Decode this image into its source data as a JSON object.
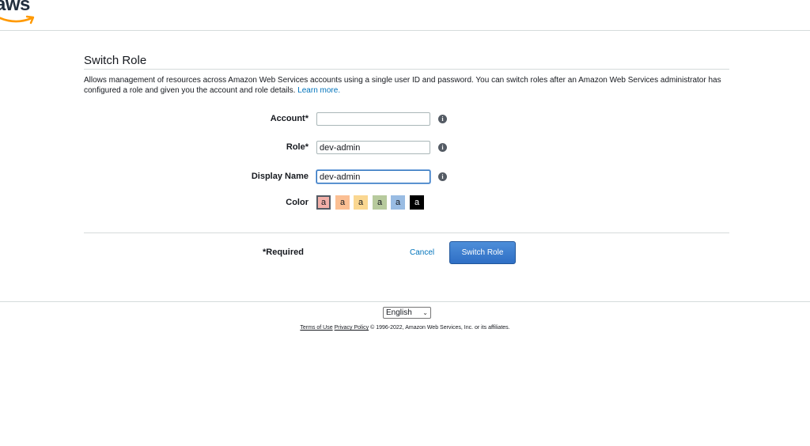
{
  "header": {
    "logo_text": "aws",
    "logo_colors": {
      "text": "#232f3e",
      "smile": "#ff9900"
    }
  },
  "page": {
    "title": "Switch Role",
    "description": "Allows management of resources across Amazon Web Services accounts using a single user ID and password. You can switch roles after an Amazon Web Services administrator has configured a role and given you the account and role details.",
    "learn_more": "Learn more."
  },
  "form": {
    "account": {
      "label": "Account*",
      "value": ""
    },
    "role": {
      "label": "Role*",
      "value": "dev-admin"
    },
    "display_name": {
      "label": "Display Name",
      "value": "dev-admin"
    },
    "color": {
      "label": "Color",
      "swatches": [
        {
          "glyph": "a",
          "color": "#f2b0a9",
          "selected": true
        },
        {
          "glyph": "a",
          "color": "#fbbf93"
        },
        {
          "glyph": "a",
          "color": "#fad791"
        },
        {
          "glyph": "a",
          "color": "#b7ca9d"
        },
        {
          "glyph": "a",
          "color": "#99bce3"
        },
        {
          "glyph": "a",
          "color": "#000000",
          "text_color": "#ffffff"
        }
      ]
    },
    "info_icon": "i",
    "required_note": "*Required",
    "cancel_label": "Cancel",
    "submit_label": "Switch Role"
  },
  "footer": {
    "language": "English",
    "terms": "Terms of Use",
    "privacy": "Privacy Policy",
    "copyright": "© 1996-2022, Amazon Web Services, Inc. or its affiliates."
  }
}
